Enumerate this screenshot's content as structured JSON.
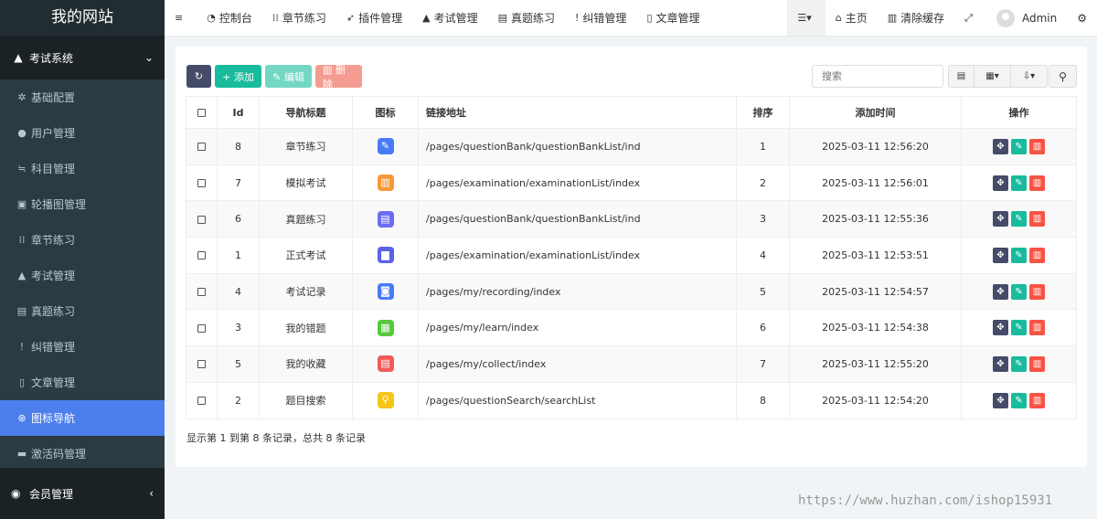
{
  "sidebar": {
    "logo": "我的网站",
    "section": {
      "label": "考试系统",
      "icon": "graduation-cap-icon",
      "toggle": "⌄"
    },
    "items": [
      {
        "label": "基础配置",
        "icon": "gear-icon",
        "glyph": "✲"
      },
      {
        "label": "用户管理",
        "icon": "user-icon",
        "glyph": "●"
      },
      {
        "label": "科目管理",
        "icon": "list-icon",
        "glyph": "≒"
      },
      {
        "label": "轮播图管理",
        "icon": "image-icon",
        "glyph": "▣"
      },
      {
        "label": "章节练习",
        "icon": "grid-icon",
        "glyph": "⁞⁞"
      },
      {
        "label": "考试管理",
        "icon": "graduation-cap-icon",
        "glyph": "▲"
      },
      {
        "label": "真题练习",
        "icon": "list-alt-icon",
        "glyph": "▤"
      },
      {
        "label": "纠错管理",
        "icon": "exclamation-circle-icon",
        "glyph": "!"
      },
      {
        "label": "文章管理",
        "icon": "file-icon",
        "glyph": "▯"
      },
      {
        "label": "图标导航",
        "icon": "compass-icon",
        "glyph": "⊛",
        "active": true
      },
      {
        "label": "激活码管理",
        "icon": "credit-card-icon",
        "glyph": "▬"
      }
    ],
    "footer": {
      "label": "会员管理",
      "icon": "user-circle-icon",
      "toggle": "‹"
    }
  },
  "topbar": {
    "items": [
      {
        "label": "",
        "icon": "bars-icon",
        "glyph": "≡"
      },
      {
        "label": "控制台",
        "icon": "dashboard-icon",
        "glyph": "◔"
      },
      {
        "label": "章节练习",
        "icon": "grid-icon",
        "glyph": "⁞⁞"
      },
      {
        "label": "插件管理",
        "icon": "rocket-icon",
        "glyph": "➶"
      },
      {
        "label": "考试管理",
        "icon": "graduation-cap-icon",
        "glyph": "▲"
      },
      {
        "label": "真题练习",
        "icon": "list-alt-icon",
        "glyph": "▤"
      },
      {
        "label": "纠错管理",
        "icon": "exclamation-circle-icon",
        "glyph": "!"
      },
      {
        "label": "文章管理",
        "icon": "file-icon",
        "glyph": "▯"
      }
    ],
    "right": [
      {
        "label": "",
        "icon": "menu-dropdown-icon",
        "glyph": "☰▾"
      },
      {
        "label": "主页",
        "icon": "home-icon",
        "glyph": "⌂"
      },
      {
        "label": "清除缓存",
        "icon": "trash-icon",
        "glyph": "▥"
      },
      {
        "label": "",
        "icon": "fullscreen-icon",
        "glyph": "⤢"
      }
    ],
    "user": "Admin",
    "settings_glyph": "⚙"
  },
  "toolbar": {
    "refresh": "↻",
    "add": "+ 添加",
    "edit": "✎ 编辑",
    "del": "▥ 删除"
  },
  "search": {
    "placeholder": "搜索"
  },
  "table": {
    "headers": [
      "",
      "Id",
      "导航标题",
      "图标",
      "链接地址",
      "排序",
      "添加时间",
      "操作"
    ],
    "rows": [
      {
        "id": "8",
        "title": "章节练习",
        "icon_color": "#4a7bf7",
        "glyph": "✎",
        "link": "/pages/questionBank/questionBankList/ind",
        "sort": "1",
        "time": "2025-03-11 12:56:20"
      },
      {
        "id": "7",
        "title": "模拟考试",
        "icon_color": "#f7983a",
        "glyph": "▥",
        "link": "/pages/examination/examinationList/index",
        "sort": "2",
        "time": "2025-03-11 12:56:01"
      },
      {
        "id": "6",
        "title": "真题练习",
        "icon_color": "#6b6ef0",
        "glyph": "▤",
        "link": "/pages/questionBank/questionBankList/ind",
        "sort": "3",
        "time": "2025-03-11 12:55:36"
      },
      {
        "id": "1",
        "title": "正式考试",
        "icon_color": "#5a62e6",
        "glyph": "▆",
        "link": "/pages/examination/examinationList/index",
        "sort": "4",
        "time": "2025-03-11 12:53:51"
      },
      {
        "id": "4",
        "title": "考试记录",
        "icon_color": "#4a7bf7",
        "glyph": "◙",
        "link": "/pages/my/recording/index",
        "sort": "5",
        "time": "2025-03-11 12:54:57"
      },
      {
        "id": "3",
        "title": "我的错题",
        "icon_color": "#57c93e",
        "glyph": "▦",
        "link": "/pages/my/learn/index",
        "sort": "6",
        "time": "2025-03-11 12:54:38"
      },
      {
        "id": "5",
        "title": "我的收藏",
        "icon_color": "#f25a5a",
        "glyph": "▤",
        "link": "/pages/my/collect/index",
        "sort": "7",
        "time": "2025-03-11 12:55:20"
      },
      {
        "id": "2",
        "title": "题目搜索",
        "icon_color": "#f5c518",
        "glyph": "⚲",
        "link": "/pages/questionSearch/searchList",
        "sort": "8",
        "time": "2025-03-11 12:54:20"
      }
    ]
  },
  "summary": "显示第 1 到第 8 条记录，总共 8 条记录",
  "watermark": "https://www.huzhan.com/ishop15931"
}
